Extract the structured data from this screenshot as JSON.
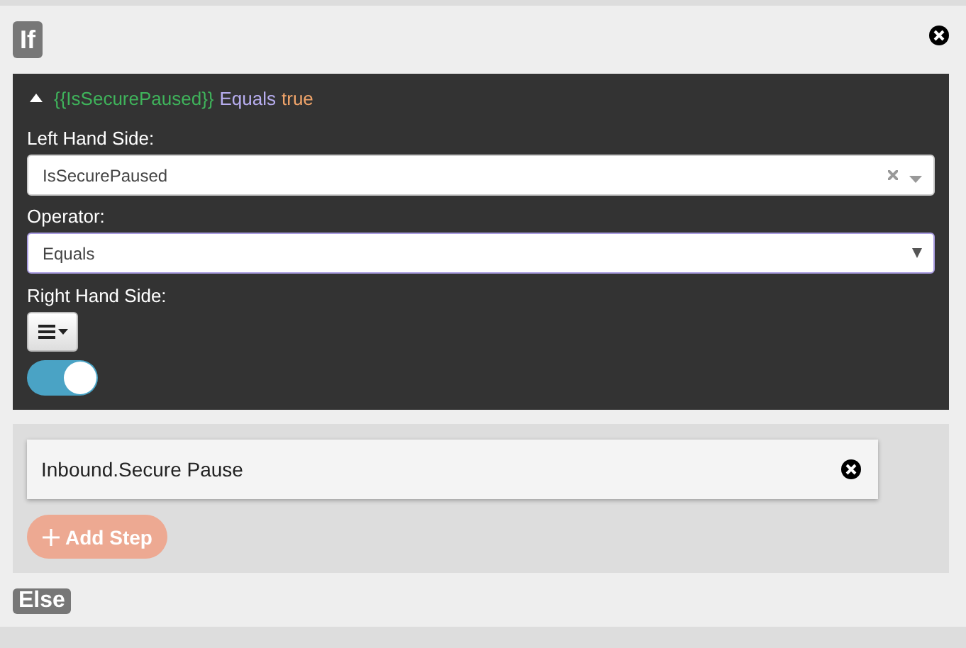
{
  "if_badge": "If",
  "condition": {
    "expanded": true,
    "variable": "{{IsSecurePaused}}",
    "operator": "Equals",
    "value": "true"
  },
  "left_hand_side": {
    "label": "Left Hand Side:",
    "value": "IsSecurePaused"
  },
  "operator": {
    "label": "Operator:",
    "value": "Equals"
  },
  "right_hand_side": {
    "label": "Right Hand Side:",
    "toggle_on": true
  },
  "steps": [
    {
      "label": "Inbound.Secure Pause"
    }
  ],
  "add_step": "Add Step",
  "else_badge": "Else"
}
